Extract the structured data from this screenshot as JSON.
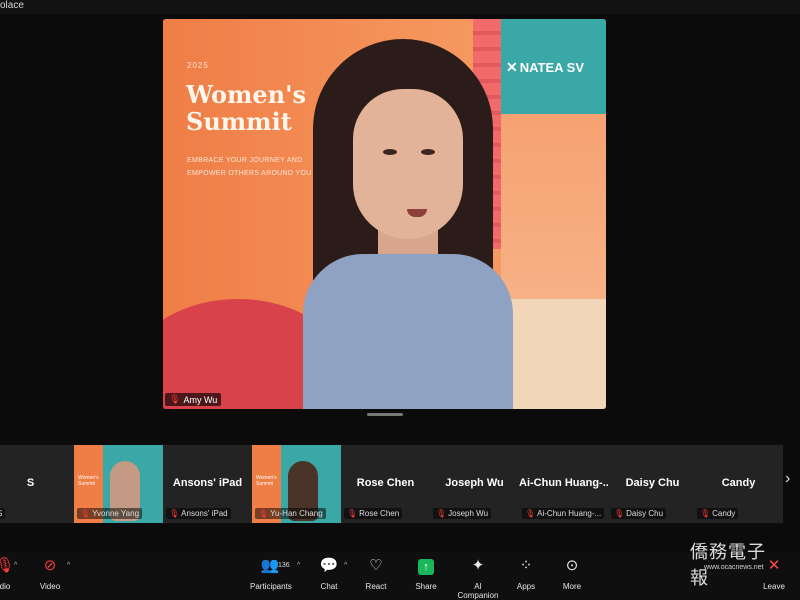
{
  "window": {
    "title_fragment": "olace"
  },
  "main_video": {
    "participant_name": "Amy Wu",
    "slide": {
      "year": "2025",
      "title": "Women's Summit",
      "tagline": "EMBRACE YOUR JOURNEY AND EMPOWER OTHERS AROUND YOU",
      "brand": "NATEA SV"
    }
  },
  "participants_strip": [
    {
      "big_name": "S",
      "small_name": "S",
      "video": false
    },
    {
      "big_name": "",
      "small_name": "Yvonne Yang",
      "video": true
    },
    {
      "big_name": "Ansons' iPad",
      "small_name": "Ansons' iPad",
      "video": false
    },
    {
      "big_name": "",
      "small_name": "Yu-Han Chang",
      "video": true
    },
    {
      "big_name": "Rose Chen",
      "small_name": "Rose Chen",
      "video": false
    },
    {
      "big_name": "Joseph Wu",
      "small_name": "Joseph Wu",
      "video": false
    },
    {
      "big_name": "Ai-Chun Huang-...",
      "small_name": "Ai-Chun Huang-...",
      "video": false
    },
    {
      "big_name": "Daisy Chu",
      "small_name": "Daisy Chu",
      "video": false
    },
    {
      "big_name": "Candy",
      "small_name": "Candy",
      "video": false
    }
  ],
  "toolbar": {
    "audio_label": "dio",
    "video_label": "Video",
    "participants_label": "Participants",
    "participants_count": "136",
    "chat_label": "Chat",
    "react_label": "React",
    "share_label": "Share",
    "ai_label": "AI Companion",
    "apps_label": "Apps",
    "more_label": "More",
    "leave_label": "Leave"
  },
  "watermark": {
    "text": "僑務電子報",
    "url": "www.ocacnews.net"
  },
  "icons": [
    "mic-muted-icon",
    "video-off-icon",
    "participants-icon",
    "chat-icon",
    "react-icon",
    "share-icon",
    "ai-companion-icon",
    "apps-icon",
    "more-icon",
    "chevron-right-icon"
  ],
  "colors": {
    "accent_green": "#1bb55a",
    "muted_red": "#ff3b3b",
    "background": "#0b0b0b"
  }
}
